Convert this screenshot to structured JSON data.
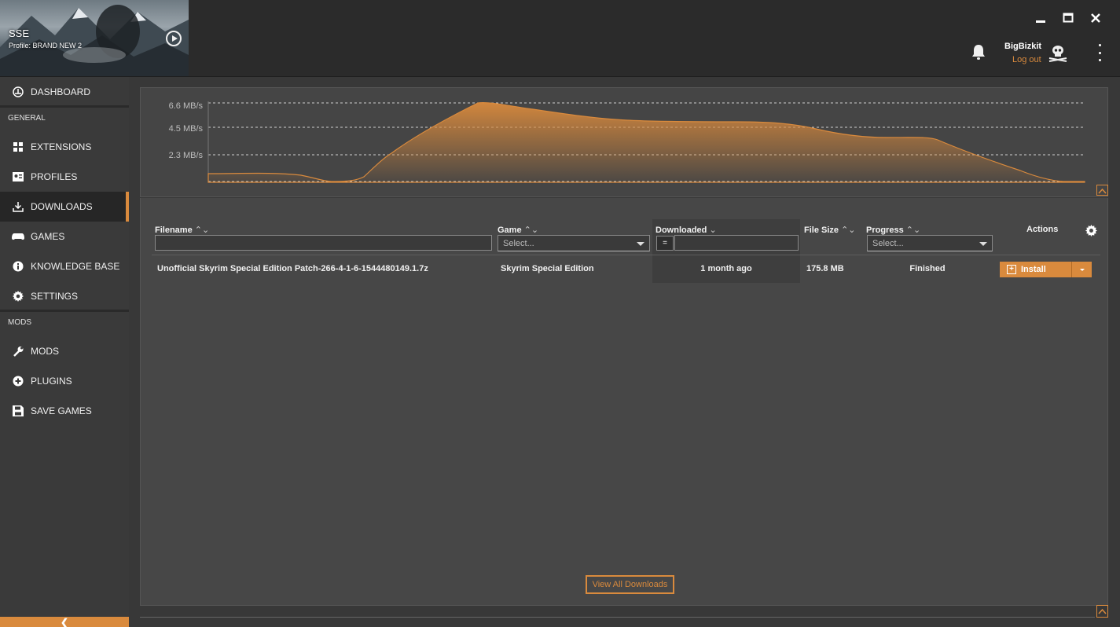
{
  "header": {
    "game_short_name": "SSE",
    "profile_label": "Profile: BRAND NEW 2",
    "user_name": "BigBizkit",
    "logout_label": "Log out",
    "window_controls": [
      "minimize-icon",
      "maximize-icon",
      "close-icon"
    ]
  },
  "sidebar": {
    "items_top": [
      {
        "label": "DASHBOARD",
        "icon": "dashboard-icon"
      }
    ],
    "section_general": "GENERAL",
    "items_general": [
      {
        "label": "EXTENSIONS",
        "icon": "extensions-icon"
      },
      {
        "label": "PROFILES",
        "icon": "profiles-icon"
      },
      {
        "label": "DOWNLOADS",
        "icon": "downloads-icon",
        "active": true
      },
      {
        "label": "GAMES",
        "icon": "gamepad-icon"
      },
      {
        "label": "KNOWLEDGE BASE",
        "icon": "info-icon"
      },
      {
        "label": "SETTINGS",
        "icon": "gear-icon"
      }
    ],
    "section_mods": "MODS",
    "items_mods": [
      {
        "label": "MODS",
        "icon": "wrench-icon"
      },
      {
        "label": "PLUGINS",
        "icon": "plus-circle-icon"
      },
      {
        "label": "SAVE GAMES",
        "icon": "save-icon"
      }
    ],
    "collapse_glyph": "❮"
  },
  "speed_graph": {
    "tick_labels": [
      "6.6 MB/s",
      "4.5 MB/s",
      "2.3 MB/s"
    ],
    "accent": "#d98a3d"
  },
  "table": {
    "columns": {
      "filename": "Filename",
      "game": "Game",
      "downloaded": "Downloaded",
      "file_size": "File Size",
      "progress": "Progress",
      "actions": "Actions"
    },
    "sort_glyph": "⌃⌄",
    "sort_desc_glyph": "⌄",
    "filters": {
      "game_placeholder": "Select...",
      "progress_placeholder": "Select...",
      "downloaded_operator": "="
    },
    "rows": [
      {
        "filename": "Unofficial Skyrim Special Edition Patch-266-4-1-6-1544480149.1.7z",
        "game": "Skyrim Special Edition",
        "downloaded": "1 month ago",
        "file_size": "175.8 MB",
        "progress": "Finished",
        "action": "Install"
      }
    ]
  },
  "footer": {
    "view_all_label": "View All Downloads"
  },
  "colors": {
    "accent": "#d98a3d",
    "sidebar_bg": "#3a3a3a",
    "panel_bg": "#474747"
  }
}
